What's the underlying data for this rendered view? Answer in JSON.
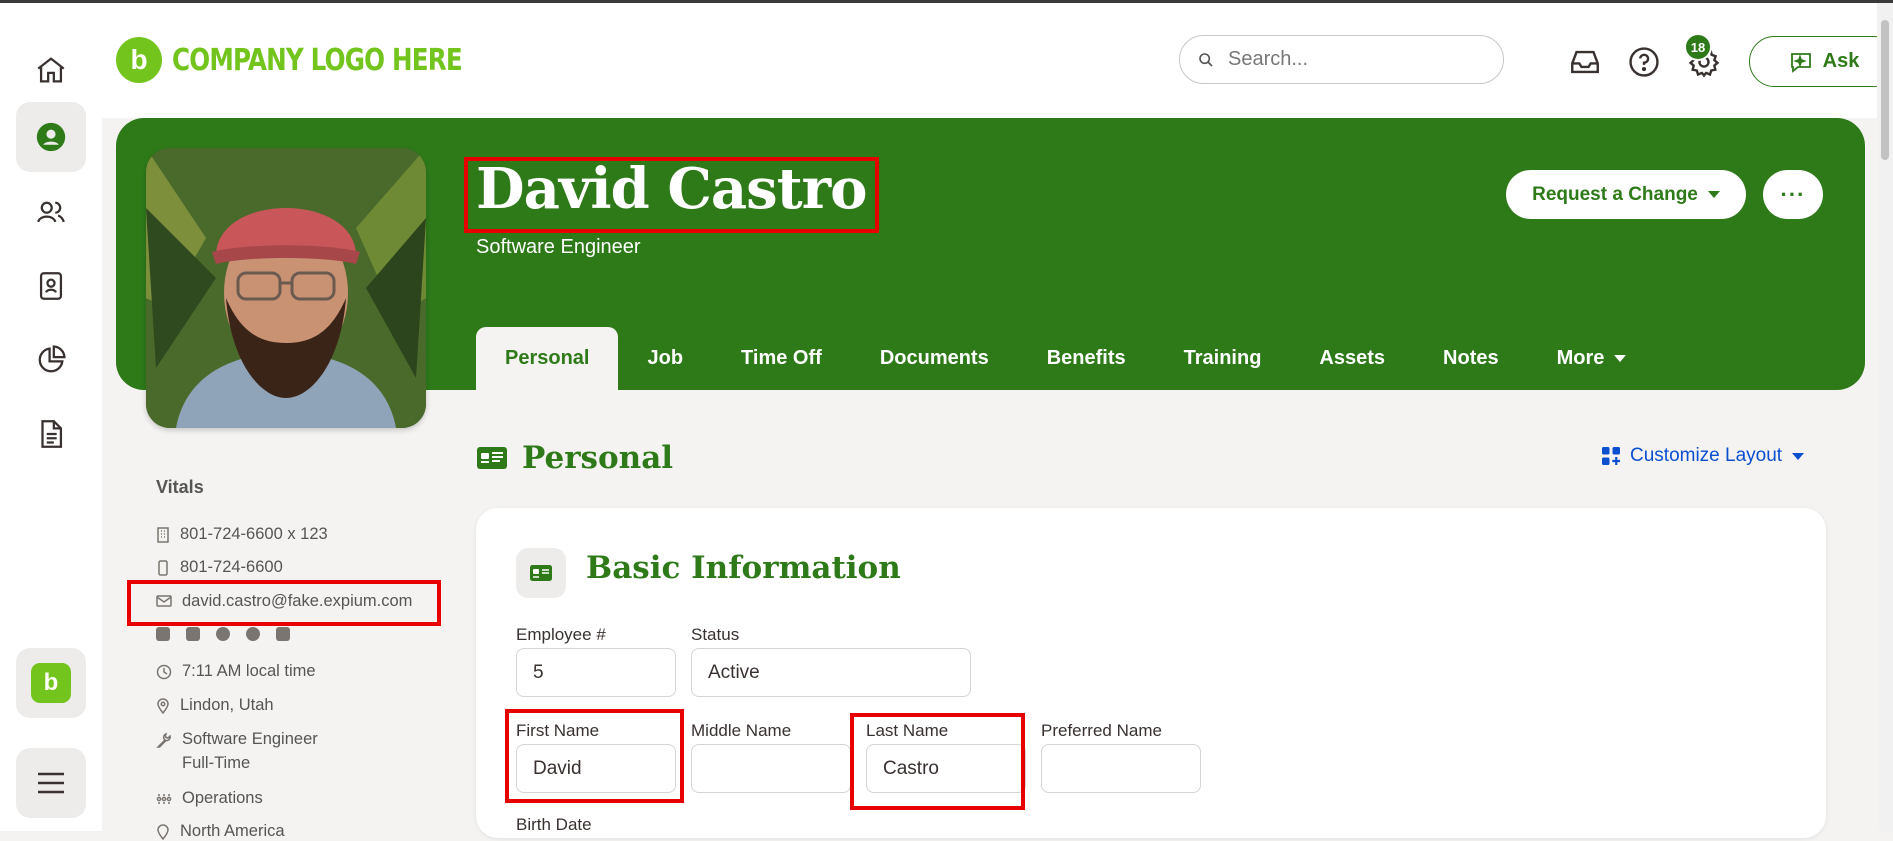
{
  "header": {
    "logo_text": "COMPANY LOGO HERE",
    "search_placeholder": "Search...",
    "inbox_badge": "18",
    "ask_label": "Ask"
  },
  "nav": {
    "items": [
      "home-icon",
      "person-icon",
      "people-icon",
      "badge-icon",
      "pie-chart-icon",
      "document-icon"
    ],
    "active": "person-icon"
  },
  "employee": {
    "name": "David Castro",
    "title": "Software Engineer",
    "request_change_label": "Request a Change",
    "more_label": "···"
  },
  "tabs": [
    "Personal",
    "Job",
    "Time Off",
    "Documents",
    "Benefits",
    "Training",
    "Assets",
    "Notes",
    "More"
  ],
  "vitals": {
    "title": "Vitals",
    "work_phone": "801-724-6600 x 123",
    "mobile_phone": "801-724-6600",
    "email": "david.castro@fake.expium.com",
    "local_time": "7:11 AM local time",
    "location": "Lindon, Utah",
    "job_title": "Software Engineer",
    "employment_type": "Full-Time",
    "department": "Operations",
    "division": "North America"
  },
  "section": {
    "title": "Personal",
    "customize_label": "Customize Layout"
  },
  "basic_info": {
    "title": "Basic Information",
    "employee_number_label": "Employee #",
    "employee_number": "5",
    "status_label": "Status",
    "status": "Active",
    "first_name_label": "First Name",
    "first_name": "David",
    "middle_name_label": "Middle Name",
    "middle_name": "",
    "last_name_label": "Last Name",
    "last_name": "Castro",
    "preferred_name_label": "Preferred Name",
    "preferred_name": "",
    "birth_date_label": "Birth Date"
  },
  "colors": {
    "brand_green": "#2e7a19",
    "logo_green": "#73c41d",
    "link_blue": "#0b4fd1",
    "highlight_red": "#e60000"
  }
}
